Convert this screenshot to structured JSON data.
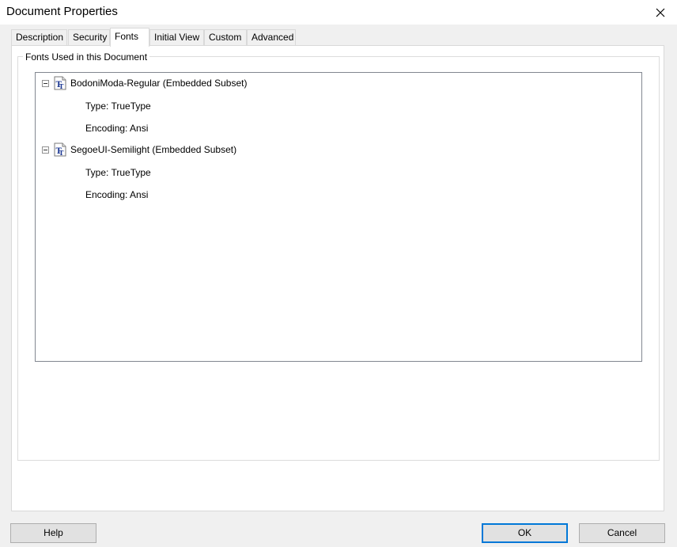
{
  "window": {
    "title": "Document Properties"
  },
  "tabs": [
    {
      "label": "Description"
    },
    {
      "label": "Security"
    },
    {
      "label": "Fonts"
    },
    {
      "label": "Initial View"
    },
    {
      "label": "Custom"
    },
    {
      "label": "Advanced"
    }
  ],
  "active_tab": "Fonts",
  "fonts_panel": {
    "group_label": "Fonts Used in this Document",
    "fonts": [
      {
        "name": "BodoniModa-Regular (Embedded Subset)",
        "type": "Type: TrueType",
        "encoding": "Encoding: Ansi"
      },
      {
        "name": "SegoeUI-Semilight (Embedded Subset)",
        "type": "Type: TrueType",
        "encoding": "Encoding: Ansi"
      }
    ]
  },
  "buttons": {
    "help": "Help",
    "ok": "OK",
    "cancel": "Cancel"
  },
  "icons": {
    "close": "close-icon",
    "font": "truetype-font-icon",
    "collapse": "collapse-icon"
  },
  "colors": {
    "default_button_border": "#0078d7",
    "font_icon_accent": "#1f3a93"
  }
}
